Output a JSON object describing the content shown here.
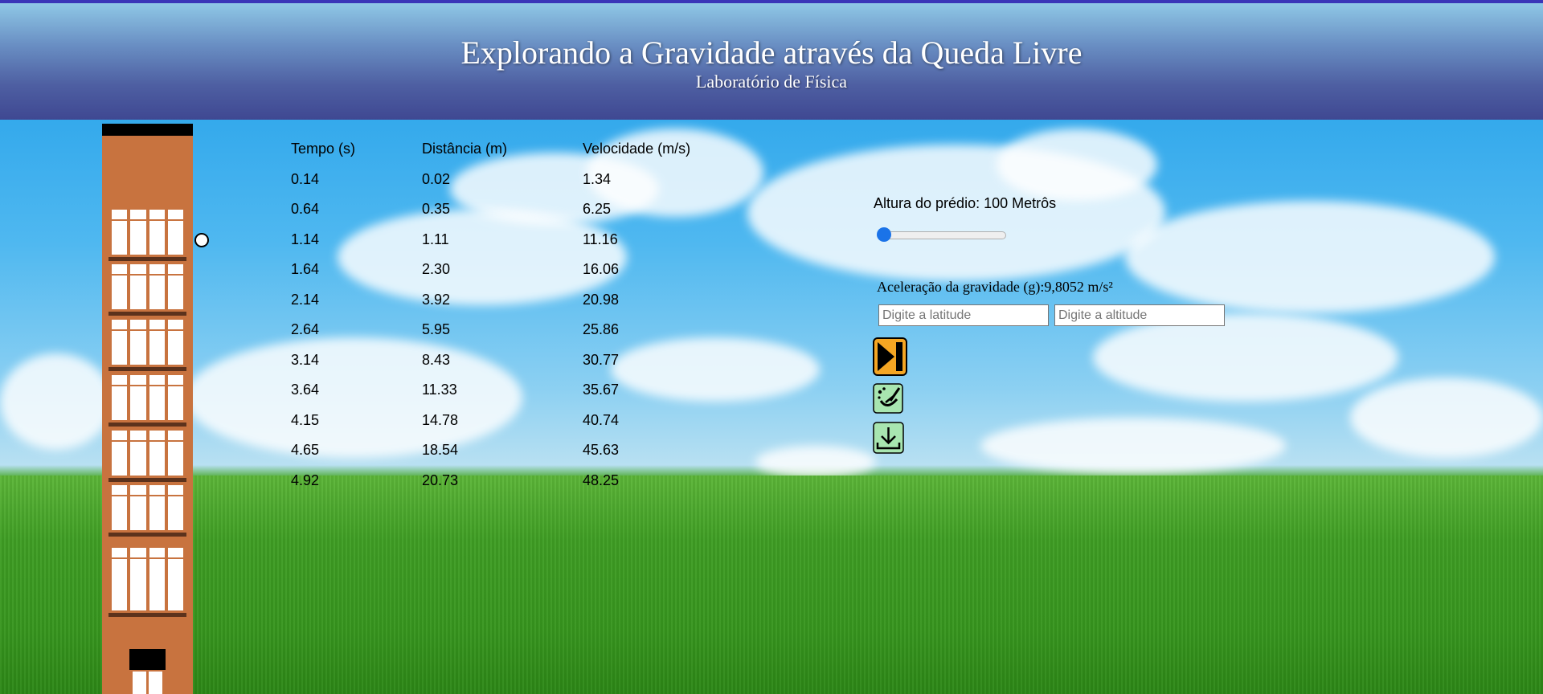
{
  "header": {
    "title": "Explorando a Gravidade através da Queda Livre",
    "subtitle": "Laboratório de Física"
  },
  "table": {
    "headers": [
      "Tempo (s)",
      "Distância (m)",
      "Velocidade (m/s)"
    ],
    "rows": [
      [
        "0.14",
        "0.02",
        "1.34"
      ],
      [
        "0.64",
        "0.35",
        "6.25"
      ],
      [
        "1.14",
        "1.11",
        "11.16"
      ],
      [
        "1.64",
        "2.30",
        "16.06"
      ],
      [
        "2.14",
        "3.92",
        "20.98"
      ],
      [
        "2.64",
        "5.95",
        "25.86"
      ],
      [
        "3.14",
        "8.43",
        "30.77"
      ],
      [
        "3.64",
        "11.33",
        "35.67"
      ],
      [
        "4.15",
        "14.78",
        "40.74"
      ],
      [
        "4.65",
        "18.54",
        "45.63"
      ],
      [
        "4.92",
        "20.73",
        "48.25"
      ]
    ]
  },
  "controls": {
    "height_label": "Altura do prédio: 100 Metrôs",
    "height_slider_value": 100,
    "gravity_label": "Aceleração da gravidade (g):9,8052 m/s²",
    "latitude_placeholder": "Digite a latitude",
    "altitude_placeholder": "Digite a altitude",
    "latitude_value": "",
    "altitude_value": ""
  },
  "buttons": {
    "play_icon": "play-skip-icon",
    "clean_icon": "broom-clean-icon",
    "download_icon": "download-icon"
  },
  "colors": {
    "building": "#c8733f",
    "button_green": "#a8e6b0",
    "button_orange": "#f5a623",
    "slider_accent": "#1a73e8"
  }
}
